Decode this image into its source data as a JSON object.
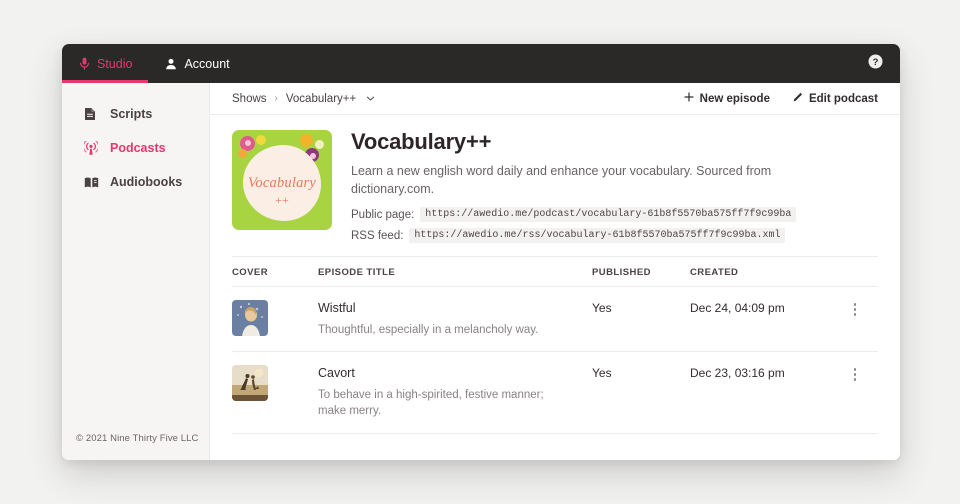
{
  "topnav": {
    "tabs": [
      {
        "label": "Studio",
        "icon": "microphone-icon",
        "active": true
      },
      {
        "label": "Account",
        "icon": "person-icon",
        "active": false
      }
    ],
    "help_icon": "help-circle-icon",
    "bar_color": "#2b2828",
    "accent_color": "#e8366f"
  },
  "sidebar": {
    "items": [
      {
        "label": "Scripts",
        "icon": "document-icon",
        "active": false
      },
      {
        "label": "Podcasts",
        "icon": "broadcast-icon",
        "active": true
      },
      {
        "label": "Audiobooks",
        "icon": "book-icon",
        "active": false
      }
    ],
    "footer": "© 2021 Nine Thirty Five LLC"
  },
  "breadcrumb": {
    "root": "Shows",
    "separator": "›",
    "current": "Vocabulary++",
    "caret_icon": "chevron-down-icon"
  },
  "toolbar": {
    "new_episode_label": "New episode",
    "new_episode_icon": "plus-icon",
    "edit_podcast_label": "Edit podcast",
    "edit_podcast_icon": "pencil-icon"
  },
  "show": {
    "cover": {
      "alt": "podcast-cover-art",
      "title_text": "Vocabulary",
      "plus_text": "++",
      "background": "#a8d442",
      "oval": "#fbeee4",
      "script_color": "#e8785e"
    },
    "title": "Vocabulary++",
    "description": "Learn a new english word daily and enhance your vocabulary. Sourced from dictionary.com.",
    "public_page_label": "Public page:",
    "public_page_url": "https://awedio.me/podcast/vocabulary-61b8f5570ba575ff7f9c99ba",
    "rss_feed_label": "RSS feed:",
    "rss_feed_url": "https://awedio.me/rss/vocabulary-61b8f5570ba575ff7f9c99ba.xml"
  },
  "table": {
    "columns": [
      "COVER",
      "EPISODE TITLE",
      "PUBLISHED",
      "CREATED"
    ],
    "rows": [
      {
        "cover": "episode-thumbnail-wistful",
        "title": "Wistful",
        "description": "Thoughtful, especially in a melancholy way.",
        "published": "Yes",
        "created": "Dec 24, 04:09 pm",
        "menu_icon": "kebab-menu-icon"
      },
      {
        "cover": "episode-thumbnail-cavort",
        "title": "Cavort",
        "description": "To behave in a high-spirited, festive manner; make merry.",
        "published": "Yes",
        "created": "Dec 23, 03:16 pm",
        "menu_icon": "kebab-menu-icon"
      }
    ]
  }
}
